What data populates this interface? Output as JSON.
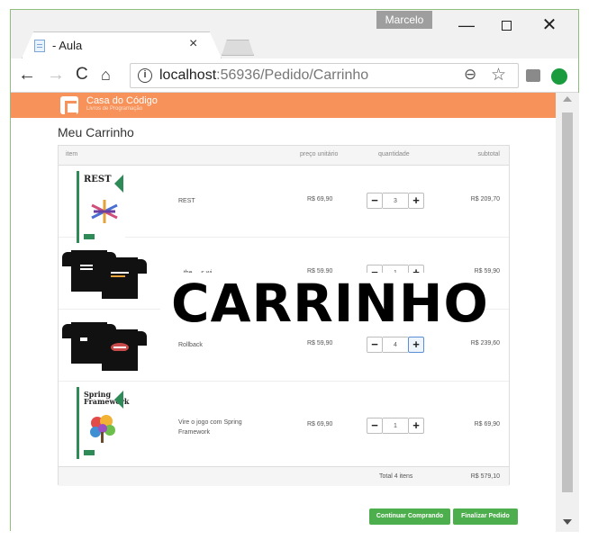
{
  "browser": {
    "tab_title": "- Aula",
    "tab_close": "×",
    "profile_name": "Marcelo",
    "win_min": "—",
    "win_close": "✕",
    "nav_back": "←",
    "nav_forward": "→",
    "nav_reload": "C",
    "nav_home": "⌂",
    "url_host": "localhost",
    "url_rest": ":56936/Pedido/Carrinho",
    "zoom_glyph": "⊖",
    "star_glyph": "☆",
    "info_glyph": "i"
  },
  "site": {
    "brand": "Casa do Código",
    "brand_tagline": "Livros de Programação",
    "accent": "#f7925a",
    "button_color": "#4cae4c"
  },
  "page": {
    "title": "Meu Carrinho",
    "overlay_text": "CARRINHO"
  },
  "cart": {
    "headers": {
      "item": "item",
      "unit_price": "preço unitário",
      "quantity": "quantidade",
      "subtotal": "subtotal"
    },
    "rows": [
      {
        "image_icon": "book-rest-cover-icon",
        "name": "REST",
        "unit_price": "R$ 69,90",
        "quantity": "3",
        "subtotal": "R$ 209,70"
      },
      {
        "image_icon": "tshirt-icon",
        "name": "...the ... s wi...",
        "unit_price": "R$ 59,90",
        "quantity": "1",
        "subtotal": "R$ 59,90"
      },
      {
        "image_icon": "tshirt-icon",
        "name": "Rollback",
        "unit_price": "R$ 59,90",
        "quantity": "4",
        "subtotal": "R$ 239,60"
      },
      {
        "image_icon": "book-spring-cover-icon",
        "name": "Vire o jogo com Spring Framework",
        "unit_price": "R$ 69,90",
        "quantity": "1",
        "subtotal": "R$ 69,90"
      }
    ],
    "minus": "−",
    "plus": "+",
    "total_label": "Total 4 itens",
    "total_value": "R$ 579,10"
  },
  "book_covers": {
    "rest_title": "REST",
    "spring_title": "Spring Framework"
  },
  "actions": {
    "continue": "Continuar Comprando",
    "finish": "Finalizar Pedido"
  }
}
